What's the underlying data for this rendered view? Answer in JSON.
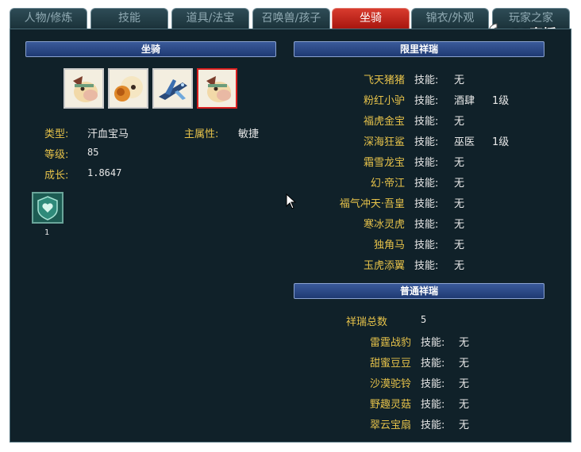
{
  "tabs": [
    {
      "label": "人物/修炼",
      "active": false
    },
    {
      "label": "技能",
      "active": false
    },
    {
      "label": "道具/法宝",
      "active": false
    },
    {
      "label": "召唤兽/孩子",
      "active": false
    },
    {
      "label": "坐骑",
      "active": true
    },
    {
      "label": "锦衣/外观",
      "active": false
    },
    {
      "label": "玩家之家",
      "active": false
    }
  ],
  "watermark": {
    "text": "CC直播"
  },
  "mount_section": {
    "title": "坐骑",
    "mount_icons": [
      "horse-mount-icon",
      "sheep-mount-icon",
      "jet-mount-icon",
      "horse-mount-icon"
    ],
    "selected_index": 3,
    "type_label": "类型:",
    "type_value": "汗血宝马",
    "attr_label": "主属性:",
    "attr_value": "敏捷",
    "level_label": "等级:",
    "level_value": "85",
    "growth_label": "成长:",
    "growth_value": "1.8647",
    "skill_count": "1"
  },
  "limited_section": {
    "title": "限里祥瑞",
    "items": [
      {
        "name": "飞天猪猪",
        "skill_label": "技能:",
        "skill": "无",
        "level": ""
      },
      {
        "name": "粉红小驴",
        "skill_label": "技能:",
        "skill": "酒肆",
        "level": "1级"
      },
      {
        "name": "福虎金宝",
        "skill_label": "技能:",
        "skill": "无",
        "level": ""
      },
      {
        "name": "深海狂鲨",
        "skill_label": "技能:",
        "skill": "巫医",
        "level": "1级"
      },
      {
        "name": "霜雪龙宝",
        "skill_label": "技能:",
        "skill": "无",
        "level": ""
      },
      {
        "name": "幻·帝江",
        "skill_label": "技能:",
        "skill": "无",
        "level": ""
      },
      {
        "name": "福气冲天·吾皇",
        "skill_label": "技能:",
        "skill": "无",
        "level": ""
      },
      {
        "name": "寒冰灵虎",
        "skill_label": "技能:",
        "skill": "无",
        "level": ""
      },
      {
        "name": "独角马",
        "skill_label": "技能:",
        "skill": "无",
        "level": ""
      },
      {
        "name": "玉虎添翼",
        "skill_label": "技能:",
        "skill": "无",
        "level": ""
      }
    ]
  },
  "normal_section": {
    "title": "普通祥瑞",
    "total_label": "祥瑞总数",
    "total_value": "5",
    "items": [
      {
        "name": "雷霆战豹",
        "skill_label": "技能:",
        "skill": "无"
      },
      {
        "name": "甜蜜豆豆",
        "skill_label": "技能:",
        "skill": "无"
      },
      {
        "name": "沙漠驼铃",
        "skill_label": "技能:",
        "skill": "无"
      },
      {
        "name": "野趣灵菇",
        "skill_label": "技能:",
        "skill": "无"
      },
      {
        "name": "翠云宝扇",
        "skill_label": "技能:",
        "skill": "无"
      }
    ]
  }
}
